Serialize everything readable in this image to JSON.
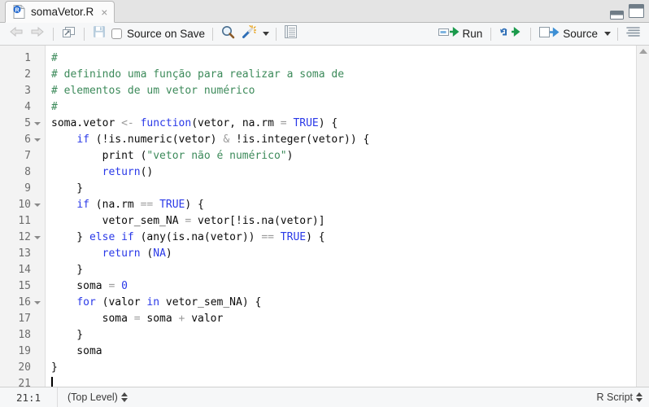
{
  "window": {
    "minimize_icon": "minimize-pane-icon",
    "maximize_icon": "maximize-pane-icon"
  },
  "tab": {
    "file_icon": "r-script-file-icon",
    "title": "somaVetor.R",
    "close": "×"
  },
  "toolbar": {
    "back_icon": "back-arrow-icon",
    "forward_icon": "forward-arrow-icon",
    "popout_icon": "show-in-new-window-icon",
    "save_icon": "save-icon",
    "source_on_save_label": "Source on Save",
    "find_icon": "find-replace-magnifier-icon",
    "wand_icon": "code-tools-magic-wand-icon",
    "wand_caret": "chevron-down-icon",
    "compile_report_icon": "compile-report-notebook-icon",
    "run_icon": "run-icon",
    "run_label": "Run",
    "rerun_icon": "re-run-previous-icon",
    "source_icon": "source-icon",
    "source_label": "Source",
    "source_caret": "chevron-down-icon",
    "outline_icon": "document-outline-icon"
  },
  "editor": {
    "lines": [
      {
        "n": "1",
        "fold": false,
        "tokens": [
          {
            "t": "#",
            "c": "cm"
          }
        ]
      },
      {
        "n": "2",
        "fold": false,
        "tokens": [
          {
            "t": "# definindo uma função para realizar a soma de",
            "c": "cm"
          }
        ]
      },
      {
        "n": "3",
        "fold": false,
        "tokens": [
          {
            "t": "# elementos de um vetor numérico",
            "c": "cm"
          }
        ]
      },
      {
        "n": "4",
        "fold": false,
        "tokens": [
          {
            "t": "#",
            "c": "cm"
          }
        ]
      },
      {
        "n": "5",
        "fold": true,
        "tokens": [
          {
            "t": "soma.vetor ",
            "c": ""
          },
          {
            "t": "<-",
            "c": "op"
          },
          {
            "t": " ",
            "c": ""
          },
          {
            "t": "function",
            "c": "kw"
          },
          {
            "t": "(vetor, na.rm ",
            "c": ""
          },
          {
            "t": "=",
            "c": "op"
          },
          {
            "t": " ",
            "c": ""
          },
          {
            "t": "TRUE",
            "c": "kw"
          },
          {
            "t": ") {",
            "c": ""
          }
        ]
      },
      {
        "n": "6",
        "fold": true,
        "tokens": [
          {
            "t": "    ",
            "c": ""
          },
          {
            "t": "if",
            "c": "kw"
          },
          {
            "t": " (!is.numeric(vetor) ",
            "c": ""
          },
          {
            "t": "&",
            "c": "op"
          },
          {
            "t": " !is.integer(vetor)) {",
            "c": ""
          }
        ]
      },
      {
        "n": "7",
        "fold": false,
        "tokens": [
          {
            "t": "        print (",
            "c": ""
          },
          {
            "t": "\"vetor não é numérico\"",
            "c": "st"
          },
          {
            "t": ")",
            "c": ""
          }
        ]
      },
      {
        "n": "8",
        "fold": false,
        "tokens": [
          {
            "t": "        ",
            "c": ""
          },
          {
            "t": "return",
            "c": "kw"
          },
          {
            "t": "()",
            "c": ""
          }
        ]
      },
      {
        "n": "9",
        "fold": false,
        "tokens": [
          {
            "t": "    }",
            "c": ""
          }
        ]
      },
      {
        "n": "10",
        "fold": true,
        "tokens": [
          {
            "t": "    ",
            "c": ""
          },
          {
            "t": "if",
            "c": "kw"
          },
          {
            "t": " (na.rm ",
            "c": ""
          },
          {
            "t": "==",
            "c": "op"
          },
          {
            "t": " ",
            "c": ""
          },
          {
            "t": "TRUE",
            "c": "kw"
          },
          {
            "t": ") {",
            "c": ""
          }
        ]
      },
      {
        "n": "11",
        "fold": false,
        "tokens": [
          {
            "t": "        vetor_sem_NA ",
            "c": ""
          },
          {
            "t": "=",
            "c": "op"
          },
          {
            "t": " vetor[!is.na(vetor)]",
            "c": ""
          }
        ]
      },
      {
        "n": "12",
        "fold": true,
        "tokens": [
          {
            "t": "    } ",
            "c": ""
          },
          {
            "t": "else if",
            "c": "kw"
          },
          {
            "t": " (any(is.na(vetor)) ",
            "c": ""
          },
          {
            "t": "==",
            "c": "op"
          },
          {
            "t": " ",
            "c": ""
          },
          {
            "t": "TRUE",
            "c": "kw"
          },
          {
            "t": ") {",
            "c": ""
          }
        ]
      },
      {
        "n": "13",
        "fold": false,
        "tokens": [
          {
            "t": "        ",
            "c": ""
          },
          {
            "t": "return",
            "c": "kw"
          },
          {
            "t": " (",
            "c": ""
          },
          {
            "t": "NA",
            "c": "kw"
          },
          {
            "t": ")",
            "c": ""
          }
        ]
      },
      {
        "n": "14",
        "fold": false,
        "tokens": [
          {
            "t": "    }",
            "c": ""
          }
        ]
      },
      {
        "n": "15",
        "fold": false,
        "tokens": [
          {
            "t": "    soma ",
            "c": ""
          },
          {
            "t": "=",
            "c": "op"
          },
          {
            "t": " ",
            "c": ""
          },
          {
            "t": "0",
            "c": "num"
          }
        ]
      },
      {
        "n": "16",
        "fold": true,
        "tokens": [
          {
            "t": "    ",
            "c": ""
          },
          {
            "t": "for",
            "c": "kw"
          },
          {
            "t": " (valor ",
            "c": ""
          },
          {
            "t": "in",
            "c": "kw"
          },
          {
            "t": " vetor_sem_NA) {",
            "c": ""
          }
        ]
      },
      {
        "n": "17",
        "fold": false,
        "tokens": [
          {
            "t": "        soma ",
            "c": ""
          },
          {
            "t": "=",
            "c": "op"
          },
          {
            "t": " soma ",
            "c": ""
          },
          {
            "t": "+",
            "c": "op"
          },
          {
            "t": " valor",
            "c": ""
          }
        ]
      },
      {
        "n": "18",
        "fold": false,
        "tokens": [
          {
            "t": "    }",
            "c": ""
          }
        ]
      },
      {
        "n": "19",
        "fold": false,
        "tokens": [
          {
            "t": "    soma",
            "c": ""
          }
        ]
      },
      {
        "n": "20",
        "fold": false,
        "tokens": [
          {
            "t": "}",
            "c": ""
          }
        ]
      },
      {
        "n": "21",
        "fold": false,
        "tokens": [],
        "cursor": true
      }
    ],
    "scroll_up_icon": "scroll-up-arrow-icon"
  },
  "statusbar": {
    "cursor_position": "21:1",
    "scope": "(Top Level)",
    "scope_stepper": "up-down-stepper-icon",
    "doc_type": "R Script",
    "doc_type_stepper": "up-down-stepper-icon"
  },
  "colors": {
    "keyword": "#2a39e8",
    "comment": "#3c8a5a",
    "string": "#3c8a5a",
    "operator": "#9a9a9a",
    "editor_bg": "#ffffff",
    "gutter_bg": "#f3f3f3",
    "toolbar_bg": "#f6f7f8"
  }
}
